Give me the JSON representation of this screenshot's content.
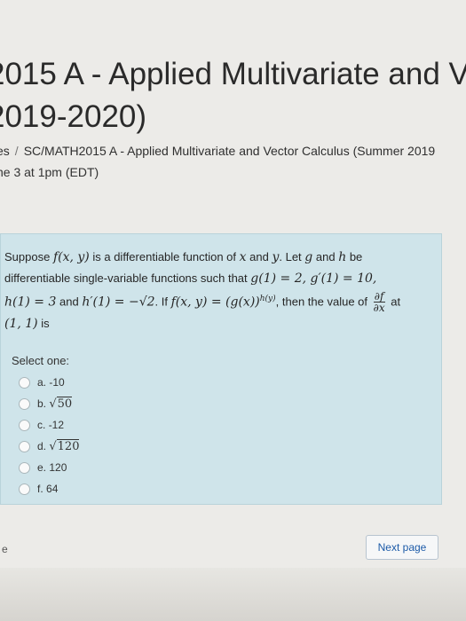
{
  "header": {
    "title_line1": "2015 A - Applied Multivariate and V",
    "title_line2": "2019-2020)"
  },
  "breadcrumb": {
    "items": [
      "es",
      "SC/MATH2015 A - Applied Multivariate and Vector Calculus (Summer 2019"
    ]
  },
  "due_text": "ne 3 at 1pm (EDT)",
  "question": {
    "line1_a": "Suppose ",
    "line1_func": "f(x, y)",
    "line1_b": " is a differentiable function of ",
    "line1_x": "x",
    "line1_c": " and ",
    "line1_y": "y",
    "line1_d": ". Let ",
    "line1_g": "g",
    "line1_e": " and ",
    "line1_h": "h",
    "line1_f": " be",
    "line2_a": "differentiable single-variable functions such that ",
    "line2_math": "g(1) = 2, g′(1) = 10,",
    "line3_math1": "h(1) = 3",
    "line3_a": " and ",
    "line3_math2": "h′(1) = −√2",
    "line3_b": ". If ",
    "line3_math3": "f(x, y) = (g(x))",
    "line3_exp": "h(y)",
    "line3_c": ", then the value of ",
    "frac_num": "∂f",
    "frac_den": "∂x",
    "line3_d": " at",
    "line4_math": "(1, 1)",
    "line4_a": " is"
  },
  "select_label": "Select one:",
  "options": [
    {
      "prefix": "a. ",
      "value": "-10"
    },
    {
      "prefix": "b. ",
      "sqrt": "50"
    },
    {
      "prefix": "c. ",
      "value": "-12"
    },
    {
      "prefix": "d. ",
      "sqrt": "120"
    },
    {
      "prefix": "e. ",
      "value": "120"
    },
    {
      "prefix": "f. ",
      "value": "64"
    }
  ],
  "footer": {
    "left_letter": "e",
    "next_label": "Next page"
  }
}
